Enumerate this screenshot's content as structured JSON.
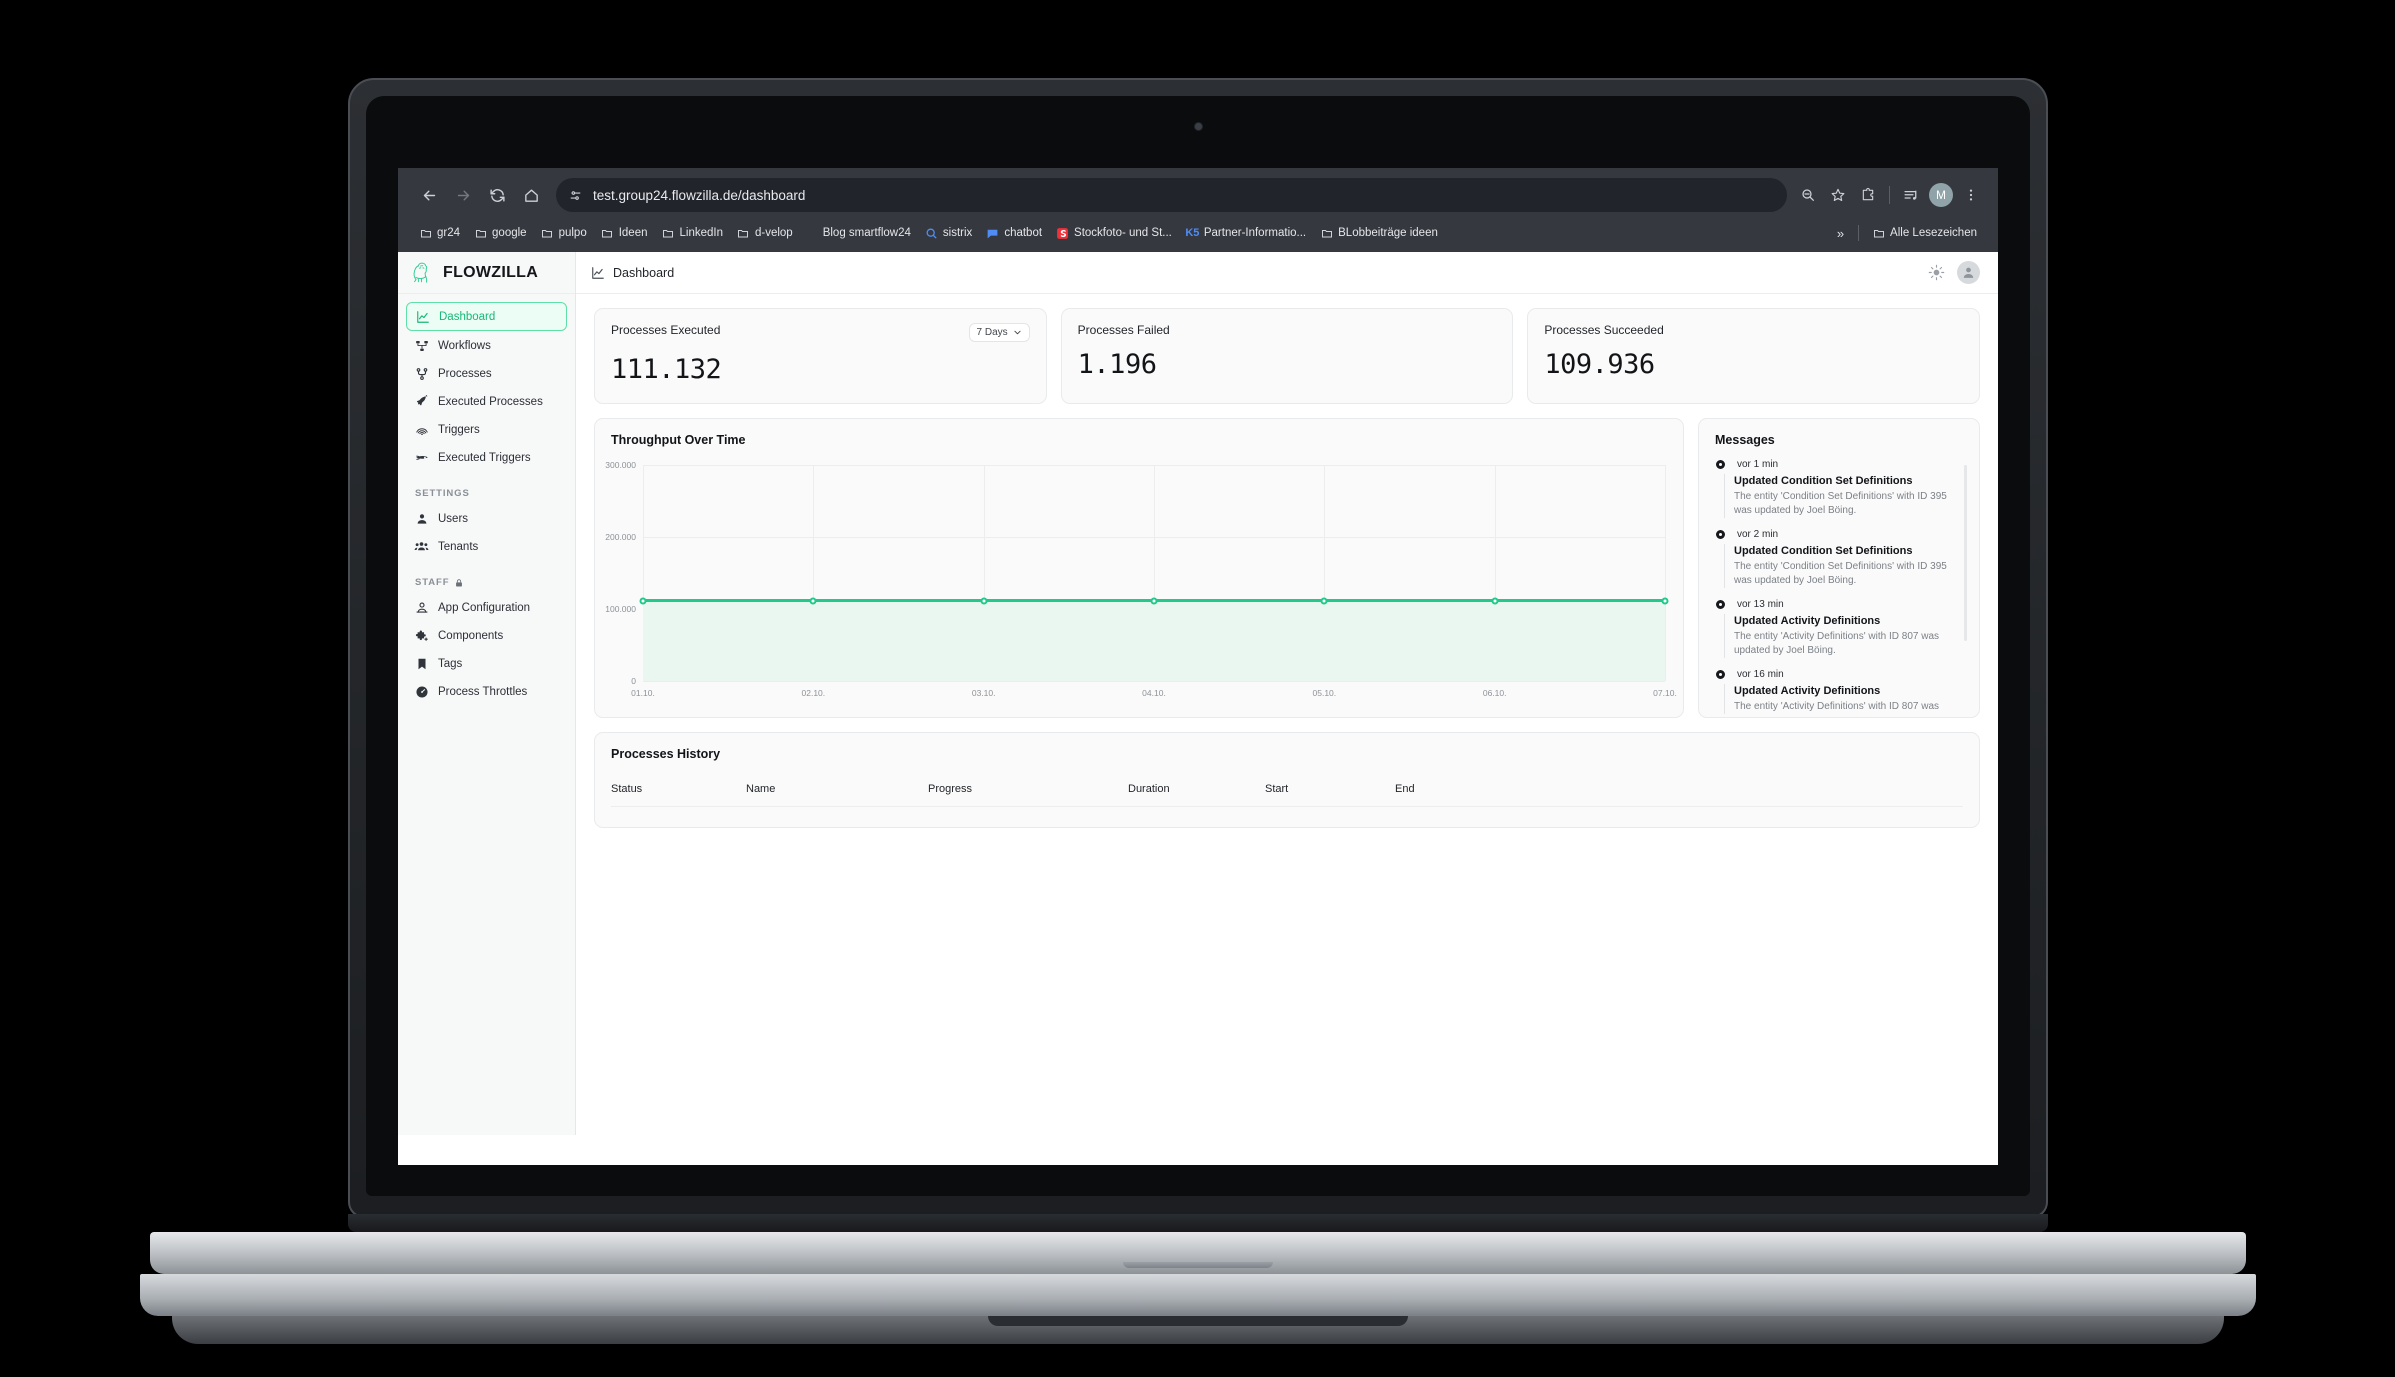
{
  "browser": {
    "url": "test.group24.flowzilla.de/dashboard",
    "nav": {
      "back_icon": "arrow-left-icon",
      "forward_icon": "arrow-right-icon",
      "reload_icon": "reload-icon",
      "home_icon": "home-icon",
      "site_info_icon": "tune-icon"
    },
    "toolbar_icons": [
      "zoom-out-icon",
      "bookmark-star-icon",
      "extensions-icon",
      "reading-list-icon",
      "profile-avatar",
      "browser-menu-icon"
    ],
    "profile_initial": "M",
    "bookmarks": [
      {
        "label": "gr24",
        "icon": "folder-icon"
      },
      {
        "label": "google",
        "icon": "folder-icon"
      },
      {
        "label": "pulpo",
        "icon": "folder-icon"
      },
      {
        "label": "Ideen",
        "icon": "folder-icon"
      },
      {
        "label": "LinkedIn",
        "icon": "folder-icon"
      },
      {
        "label": "d-velop",
        "icon": "folder-icon"
      },
      {
        "label": "Blog smartflow24",
        "icon": "none"
      },
      {
        "label": "sistrix",
        "icon": "search-circle-icon"
      },
      {
        "label": "chatbot",
        "icon": "chat-icon"
      },
      {
        "label": "Stockfoto- und St...",
        "icon": "red-square-icon"
      },
      {
        "label": "Partner-Informatio...",
        "icon": "k5-icon"
      },
      {
        "label": "BLobbeiträge ideen",
        "icon": "folder-icon"
      }
    ],
    "overflow_label": "»",
    "all_bookmarks_label": "Alle Lesezeichen",
    "all_bookmarks_icon": "folder-icon"
  },
  "app": {
    "brand": {
      "name": "FLOWZILLA",
      "logo_icon": "gorilla-logo-icon"
    },
    "sidebar": {
      "items": [
        {
          "label": "Dashboard",
          "icon": "chart-line-icon",
          "active": true
        },
        {
          "label": "Workflows",
          "icon": "workflow-icon",
          "active": false
        },
        {
          "label": "Processes",
          "icon": "process-branch-icon",
          "active": false
        },
        {
          "label": "Executed Processes",
          "icon": "rocket-icon",
          "active": false
        },
        {
          "label": "Triggers",
          "icon": "fingerprint-icon",
          "active": false
        },
        {
          "label": "Executed Triggers",
          "icon": "trigger-fired-icon",
          "active": false
        }
      ],
      "sections": [
        {
          "label": "SETTINGS",
          "locked": false,
          "items": [
            {
              "label": "Users",
              "icon": "user-icon"
            },
            {
              "label": "Tenants",
              "icon": "users-group-icon"
            }
          ]
        },
        {
          "label": "STAFF",
          "locked": true,
          "lock_icon": "lock-icon",
          "items": [
            {
              "label": "App Configuration",
              "icon": "user-gear-icon"
            },
            {
              "label": "Components",
              "icon": "puzzle-icon"
            },
            {
              "label": "Tags",
              "icon": "bookmark-icon"
            },
            {
              "label": "Process Throttles",
              "icon": "gauge-icon"
            }
          ]
        }
      ]
    },
    "topbar": {
      "breadcrumb": "Dashboard",
      "breadcrumb_icon": "chart-line-icon",
      "theme_toggle_icon": "sun-icon",
      "account_icon": "account-avatar-icon"
    },
    "kpis": [
      {
        "title": "Processes Executed",
        "value": "111.132",
        "filter": "7 Days",
        "filter_icon": "chevron-down-icon"
      },
      {
        "title": "Processes Failed",
        "value": "1.196"
      },
      {
        "title": "Processes Succeeded",
        "value": "109.936"
      }
    ],
    "messages": {
      "title": "Messages",
      "items": [
        {
          "time": "vor 1 min",
          "title": "Updated Condition Set Definitions",
          "text": "The entity 'Condition Set Definitions' with ID 395 was updated by Joel Böing."
        },
        {
          "time": "vor 2 min",
          "title": "Updated Condition Set Definitions",
          "text": "The entity 'Condition Set Definitions' with ID 395 was updated by Joel Böing."
        },
        {
          "time": "vor 13 min",
          "title": "Updated Activity Definitions",
          "text": "The entity 'Activity Definitions' with ID 807 was updated by Joel Böing."
        },
        {
          "time": "vor 16 min",
          "title": "Updated Activity Definitions",
          "text": "The entity 'Activity Definitions' with ID 807 was"
        }
      ]
    },
    "history": {
      "title": "Processes History",
      "columns": [
        "Status",
        "Name",
        "Progress",
        "Duration",
        "Start",
        "End"
      ],
      "rows": []
    }
  },
  "chart_data": {
    "type": "area",
    "title": "Throughput Over Time",
    "xlabel": "",
    "ylabel": "",
    "categories": [
      "01.10.",
      "02.10.",
      "03.10.",
      "04.10.",
      "05.10.",
      "06.10.",
      "07.10."
    ],
    "values": [
      111132,
      111132,
      111132,
      111132,
      111132,
      111132,
      111132
    ],
    "ylim": [
      0,
      300000
    ],
    "yticks": [
      0,
      100000,
      200000,
      300000
    ],
    "ytick_labels": [
      "0",
      "100.000",
      "200.000",
      "300.000"
    ],
    "grid": true,
    "legend": false,
    "line_color": "#21c98a",
    "fill_color": "#e9f7f0"
  }
}
